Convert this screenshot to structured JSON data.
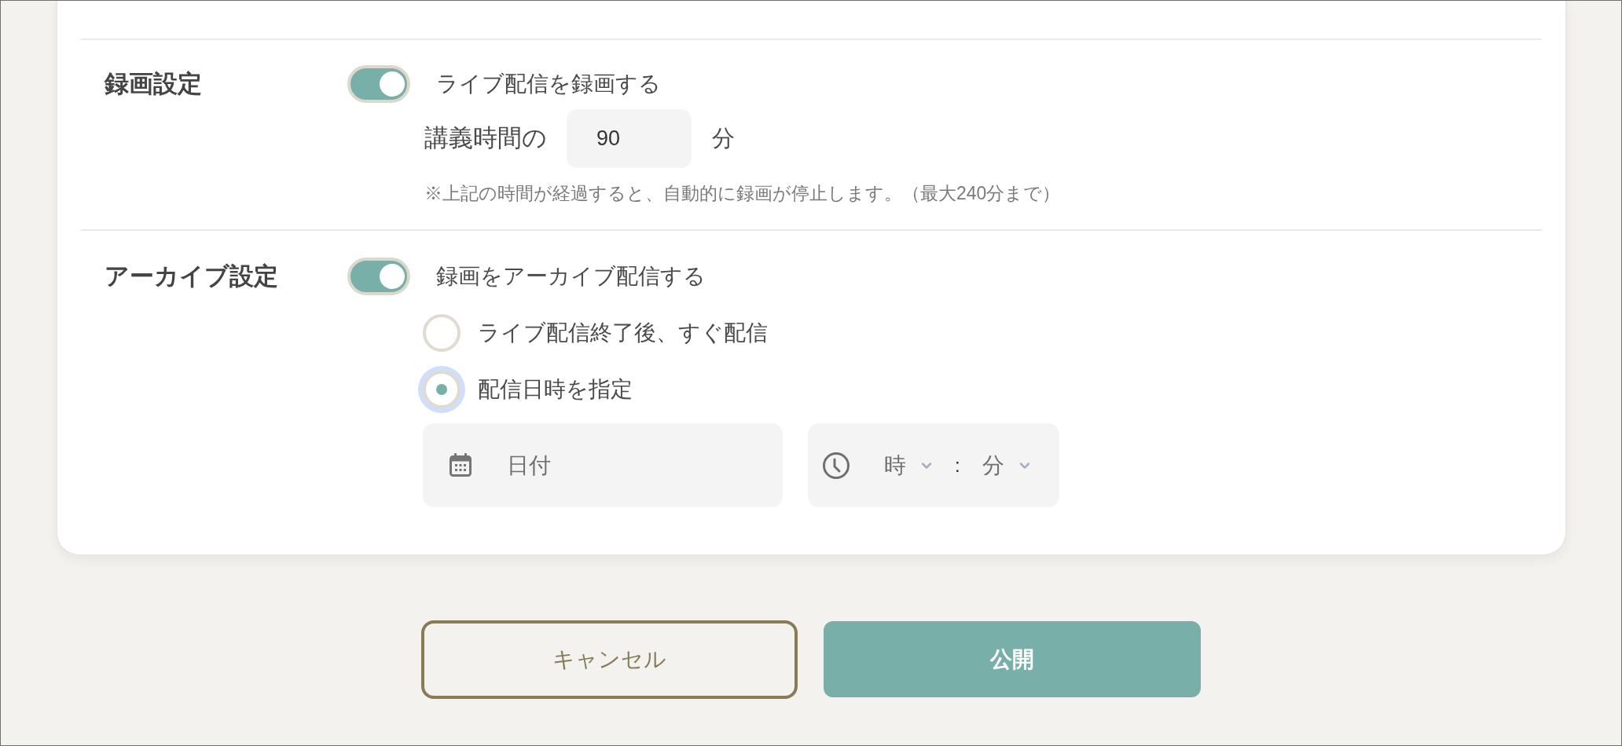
{
  "sections": [
    {
      "kind": "recording",
      "label": "録画設定",
      "toggle": {
        "label": "ライブ配信を録画する",
        "on": true
      },
      "duration": {
        "prefix": "講義時間の",
        "value": "90",
        "unit": "分"
      },
      "note": "※上記の時間が経過すると、自動的に録画が停止します。（最大240分まで）"
    },
    {
      "kind": "archive",
      "label": "アーカイブ設定",
      "toggle": {
        "label": "録画をアーカイブ配信する",
        "on": true
      },
      "options": [
        {
          "label": "ライブ配信終了後、すぐ配信",
          "selected": false,
          "focused": false
        },
        {
          "label": "配信日時を指定",
          "selected": true,
          "focused": true
        }
      ],
      "date_field": {
        "placeholder": "日付"
      },
      "time_field": {
        "hour": {
          "placeholder": "時"
        },
        "separator": ":",
        "minute": {
          "placeholder": "分"
        }
      }
    }
  ],
  "buttons": [
    {
      "kind": "secondary",
      "label": "キャンセル"
    },
    {
      "kind": "primary",
      "label": "公開"
    }
  ]
}
